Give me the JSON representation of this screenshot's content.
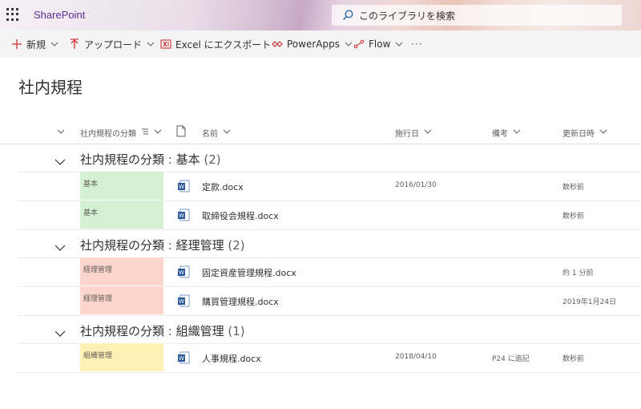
{
  "suite": {
    "brand": "SharePoint",
    "search_placeholder": "このライブラリを検索"
  },
  "commands": [
    {
      "label": "新規",
      "icon": "plus-icon"
    },
    {
      "label": "アップロード",
      "icon": "upload-icon"
    },
    {
      "label": "Excel にエクスポート",
      "icon": "excel-icon"
    },
    {
      "label": "PowerApps",
      "icon": "powerapps-icon"
    },
    {
      "label": "Flow",
      "icon": "flow-icon"
    },
    {
      "label": "···",
      "icon": "more-icon"
    }
  ],
  "page": {
    "title": "社内規程"
  },
  "columns": {
    "category": "社内規程の分類",
    "name": "名前",
    "effective": "施行日",
    "note": "備考",
    "modified": "更新日時"
  },
  "groups": [
    {
      "prefix": "社内規程の分類",
      "sep": " : ",
      "value": "基本",
      "count": "(2)",
      "rows": [
        {
          "category": "基本",
          "name": "定款.docx",
          "effective": "2016/01/30",
          "note": "",
          "modified": "数秒前"
        },
        {
          "category": "基本",
          "name": "取締役会規程.docx",
          "effective": "",
          "note": "",
          "modified": "数秒前"
        }
      ]
    },
    {
      "prefix": "社内規程の分類",
      "sep": " : ",
      "value": "経理管理",
      "count": "(2)",
      "rows": [
        {
          "category": "経理管理",
          "name": "固定資産管理規程.docx",
          "effective": "",
          "note": "",
          "modified": "約 1 分前"
        },
        {
          "category": "経理管理",
          "name": "購買管理規程.docx",
          "effective": "",
          "note": "",
          "modified": "2019年1月24日"
        }
      ]
    },
    {
      "prefix": "社内規程の分類",
      "sep": " : ",
      "value": "組織管理",
      "count": "(1)",
      "rows": [
        {
          "category": "組織管理",
          "name": "人事規程.docx",
          "effective": "2018/04/10",
          "note": "P24 に追記",
          "modified": "数秒前"
        }
      ]
    }
  ],
  "colors": {
    "category_basic": "#d4f0d2",
    "category_accounting": "#fdd5cc",
    "category_org": "#fff0b3",
    "brand": "#5b2d8f",
    "command_icon": "#d13438"
  }
}
